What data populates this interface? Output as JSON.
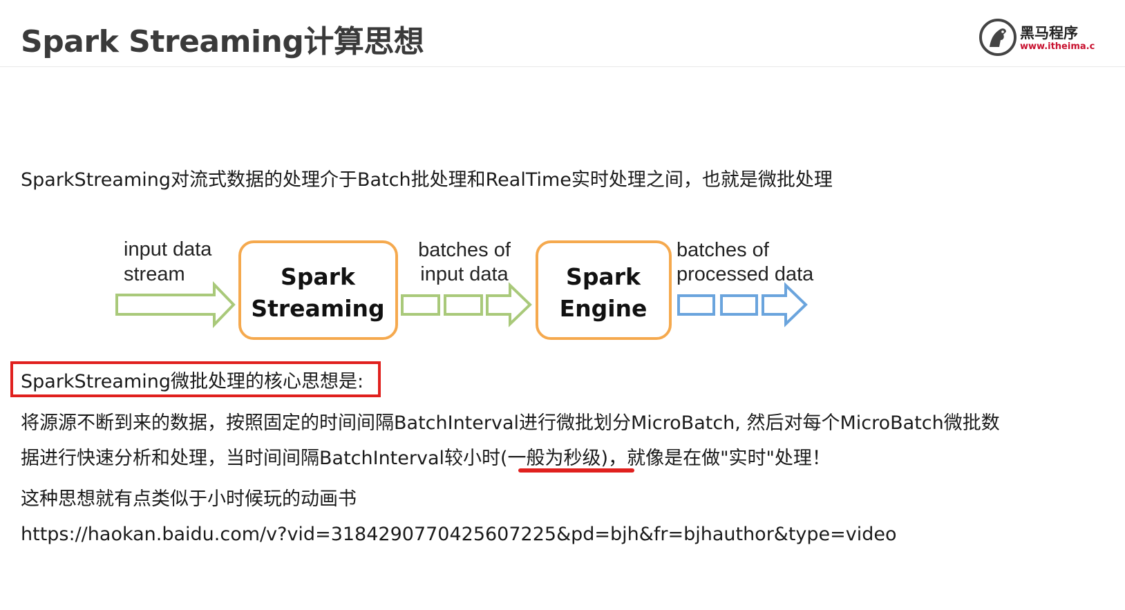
{
  "page": {
    "title": "Spark Streaming计算思想"
  },
  "logo": {
    "name": "黑马程序",
    "url": "www.itheima.c",
    "icon": "horse-head-icon"
  },
  "content": {
    "intro": "SparkStreaming对流式数据的处理介于Batch批处理和RealTime实时处理之间，也就是微批处理",
    "core_heading": "SparkStreaming微批处理的核心思想是:",
    "para_1": "将源源不断到来的数据，按照固定的时间间隔BatchInterval进行微批划分MicroBatch, 然后对每个MicroBatch微批数",
    "para_2": "据进行快速分析和处理，当时间间隔BatchInterval较小时(一般为秒级)，就像是在做\"实时\"处理！",
    "para_3": "这种思想就有点类似于小时候玩的动画书",
    "link": "https://haokan.baidu.com/v?vid=3184290770425607225&pd=bjh&fr=bjhauthor&type=video"
  },
  "diagram": {
    "input_label_line1": "input data",
    "input_label_line2": "stream",
    "box1_line1": "Spark",
    "box1_line2": "Streaming",
    "batches_in_line1": "batches of",
    "batches_in_line2": "input data",
    "box2_line1": "Spark",
    "box2_line2": "Engine",
    "batches_out_line1": "batches of",
    "batches_out_line2": "processed data",
    "colors": {
      "input_arrow": "#a9c97a",
      "box_border": "#f5a94e",
      "output_arrow": "#6aa4dd",
      "highlight": "#e0201e"
    }
  }
}
